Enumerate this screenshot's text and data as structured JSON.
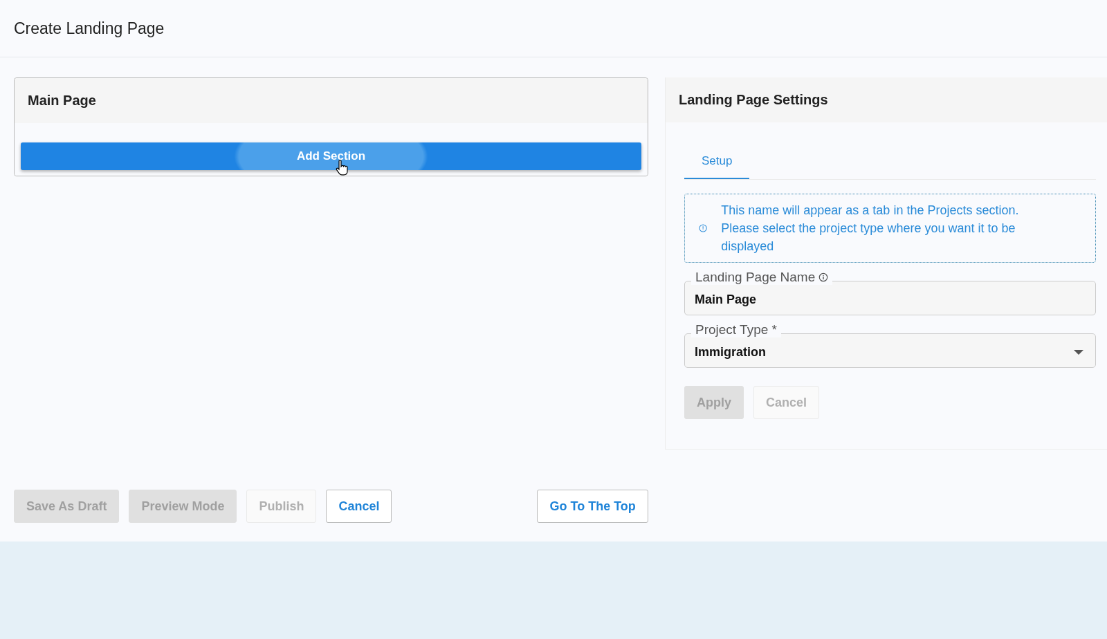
{
  "page": {
    "title": "Create Landing Page"
  },
  "main_card": {
    "title": "Main Page",
    "add_button": "Add Section"
  },
  "settings": {
    "title": "Landing Page Settings",
    "tabs": [
      {
        "label": "Setup",
        "selected": true
      }
    ],
    "info": "This name will appear as a tab in the Projects section. Please select the project type where you want it to be displayed",
    "fields": [
      {
        "kind": "text",
        "label": "Landing Page Name",
        "value": "Main Page",
        "info_icon": true
      },
      {
        "kind": "select",
        "label": "Project Type *",
        "value": "Immigration",
        "info_icon": false
      }
    ],
    "buttons": [
      {
        "label": "Apply",
        "disabled": true
      },
      {
        "label": "Cancel",
        "disabled": true
      }
    ]
  },
  "footer_buttons": [
    {
      "label": "Save As Draft",
      "disabled": true
    },
    {
      "label": "Preview Mode",
      "disabled": true
    },
    {
      "label": "Publish",
      "disabled": true
    },
    {
      "label": "Cancel",
      "disabled": false
    }
  ],
  "top_button": {
    "label": "Go To The Top",
    "disabled": false
  }
}
